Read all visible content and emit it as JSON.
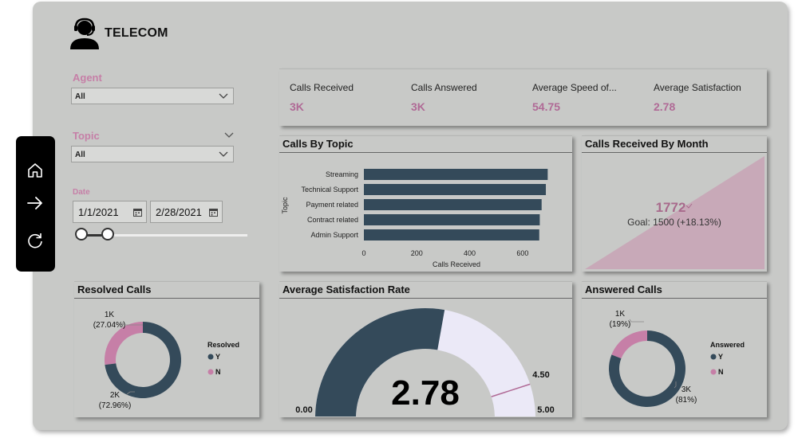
{
  "app": {
    "title": "TELECOM"
  },
  "filters": {
    "agent": {
      "label": "Agent",
      "value": "All"
    },
    "topic": {
      "label": "Topic",
      "value": "All"
    },
    "date": {
      "label": "Date",
      "start": "1/1/2021",
      "end": "2/28/2021"
    }
  },
  "kpis": [
    {
      "label": "Calls Received",
      "value": "3K"
    },
    {
      "label": "Calls Answered",
      "value": "3K"
    },
    {
      "label": "Average Speed of...",
      "value": "54.75"
    },
    {
      "label": "Average Satisfaction",
      "value": "2.78"
    }
  ],
  "calls_by_topic": {
    "title": "Calls By Topic"
  },
  "calls_by_month": {
    "title": "Calls Received By Month",
    "value": "1772",
    "goal_text": "Goal: 1500 (+18.13%)"
  },
  "resolved": {
    "title": "Resolved Calls"
  },
  "satisfaction": {
    "title": "Average Satisfaction Rate"
  },
  "answered": {
    "title": "Answered Calls"
  },
  "colors": {
    "pink": "#c67fa7",
    "dark": "#344a5a",
    "lavender": "#ebe9f7",
    "canvas": "#c8c9c7"
  },
  "icons": [
    "headset-agent-icon",
    "chevron-down-icon",
    "calendar-icon",
    "home-icon",
    "arrow-right-icon",
    "refresh-icon"
  ],
  "chart_data": [
    {
      "type": "bar",
      "orientation": "horizontal",
      "categories": [
        "Streaming",
        "Technical Support",
        "Payment related",
        "Contract related",
        "Admin Support"
      ],
      "values": [
        695,
        688,
        672,
        665,
        663
      ],
      "xlabel": "Calls Received",
      "ylabel": "Topic",
      "xlim": [
        0,
        700
      ],
      "xticks": [
        "0",
        "200",
        "400",
        "600"
      ],
      "color": "#344a5a"
    },
    {
      "type": "pie",
      "variant": "donut",
      "legend_title": "Resolved",
      "legend": [
        "Y",
        "N"
      ],
      "slices": [
        {
          "name": "Y",
          "value": 72.96,
          "label_value": "2K",
          "label_pct": "(72.96%)",
          "color": "#344a5a"
        },
        {
          "name": "N",
          "value": 27.04,
          "label_value": "1K",
          "label_pct": "(27.04%)",
          "color": "#c67fa7"
        }
      ]
    },
    {
      "type": "gauge",
      "value": 2.78,
      "display_value": "2.78",
      "min": 0,
      "max": 5,
      "target": 4.5,
      "min_label": "0.00",
      "max_label": "5.00",
      "target_label": "4.50"
    },
    {
      "type": "pie",
      "variant": "donut",
      "legend_title": "Answered",
      "legend": [
        "Y",
        "N"
      ],
      "slices": [
        {
          "name": "Y",
          "value": 81,
          "label_value": "3K",
          "label_pct": "(81%)",
          "color": "#344a5a"
        },
        {
          "name": "N",
          "value": 19,
          "label_value": "1K",
          "label_pct": "(19%)",
          "color": "#c67fa7"
        }
      ]
    }
  ]
}
